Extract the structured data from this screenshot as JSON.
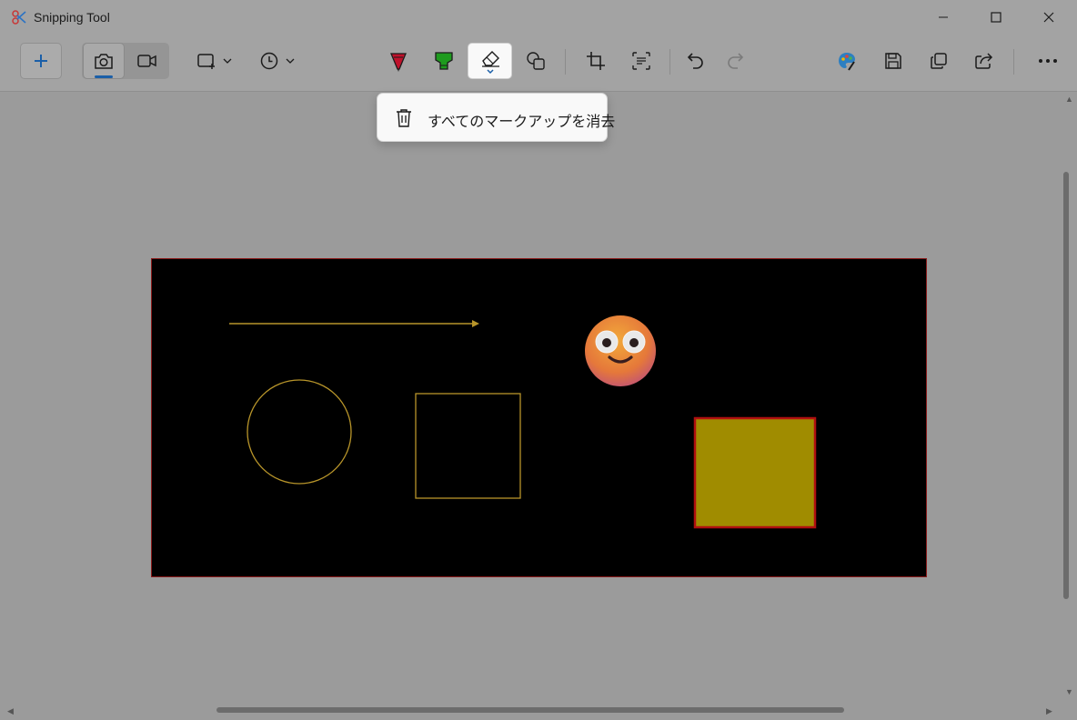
{
  "window": {
    "title": "Snipping Tool"
  },
  "toolbar": {
    "buttons": [
      {
        "name": "new-snip",
        "icon": "plus-icon"
      },
      {
        "name": "snip-mode-screenshot",
        "icon": "camera-icon",
        "selected": true
      },
      {
        "name": "snip-mode-video",
        "icon": "video-camera-icon"
      },
      {
        "name": "snip-shape",
        "icon": "rectangle-snip-icon"
      },
      {
        "name": "snip-delay",
        "icon": "clock-icon"
      },
      {
        "name": "ballpoint-pen",
        "icon": "pen-icon",
        "color": "#c0112b"
      },
      {
        "name": "highlighter",
        "icon": "highlighter-icon",
        "color": "#1e9b1e"
      },
      {
        "name": "eraser",
        "icon": "eraser-icon",
        "active": true
      },
      {
        "name": "shapes",
        "icon": "shapes-icon"
      },
      {
        "name": "crop",
        "icon": "crop-icon"
      },
      {
        "name": "text-actions",
        "icon": "text-scan-icon"
      },
      {
        "name": "undo",
        "icon": "undo-icon"
      },
      {
        "name": "redo",
        "icon": "redo-icon",
        "disabled": true
      },
      {
        "name": "edit-in-paint",
        "icon": "paint-palette-icon"
      },
      {
        "name": "save",
        "icon": "save-icon"
      },
      {
        "name": "copy",
        "icon": "copy-icon"
      },
      {
        "name": "share",
        "icon": "share-icon"
      },
      {
        "name": "more",
        "icon": "more-icon"
      }
    ]
  },
  "eraser_menu": {
    "items": [
      {
        "label": "すべてのマークアップを消去",
        "icon": "trash-icon"
      }
    ]
  },
  "capture": {
    "background": "#000000",
    "border_color": "#8a1a1a",
    "stroke_color": "#b8952a",
    "fill_square_color": "#a08c00",
    "fill_square_border": "#b01010",
    "emoji": "smiling-face-emoji"
  },
  "colors": {
    "overlay": "#9b9b9b",
    "accent": "#1b5fa8"
  }
}
